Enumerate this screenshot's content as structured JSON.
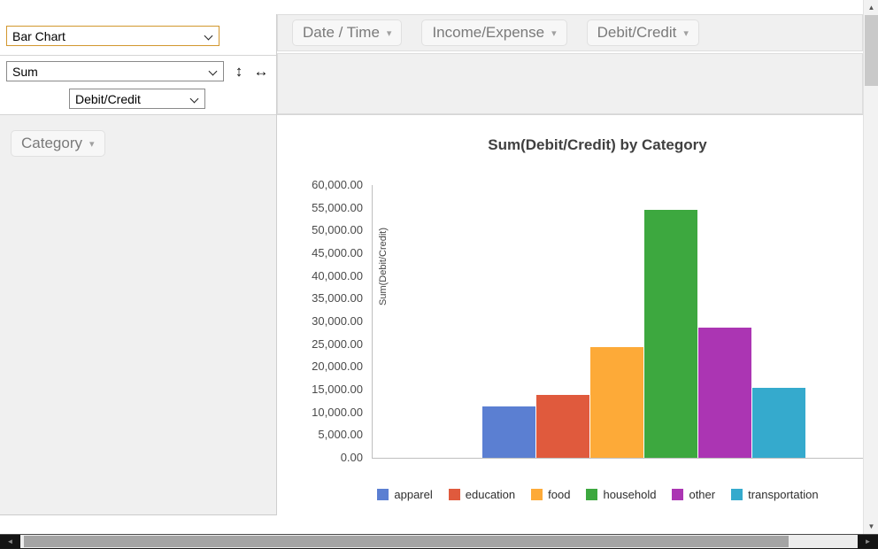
{
  "controls": {
    "renderer_select": {
      "value": "Bar Chart"
    },
    "aggregator_select": {
      "value": "Sum"
    },
    "aggregator_arg_select": {
      "value": "Debit/Credit"
    },
    "order_arrows": {
      "vertical": "↕",
      "horizontal": "↔"
    }
  },
  "attribute_pills": {
    "caret_glyph": "▾",
    "unused": [
      "Date / Time",
      "Income/Expense",
      "Debit/Credit"
    ],
    "rows": [
      "Category"
    ],
    "cols": []
  },
  "icons": {
    "scroll_up": "▲",
    "scroll_down": "▼",
    "scroll_left": "◄",
    "scroll_right": "►"
  },
  "chart_data": {
    "type": "bar",
    "title": "Sum(Debit/Credit) by Category",
    "xlabel": "",
    "ylabel": "Sum(Debit/Credit)",
    "categories": [
      "apparel",
      "education",
      "food",
      "household",
      "other",
      "transportation"
    ],
    "values": [
      11300,
      13800,
      24400,
      54600,
      28700,
      15400
    ],
    "colors": [
      "#5b7fd2",
      "#e05a3d",
      "#fdaa38",
      "#3da83f",
      "#ab35b3",
      "#35aacd"
    ],
    "ylim": [
      0,
      60000
    ],
    "ytick_labels": [
      "0.00",
      "5,000.00",
      "10,000.00",
      "15,000.00",
      "20,000.00",
      "25,000.00",
      "30,000.00",
      "35,000.00",
      "40,000.00",
      "45,000.00",
      "50,000.00",
      "55,000.00",
      "60,000.00"
    ],
    "legend_entries": [
      "apparel",
      "education",
      "food",
      "household",
      "other",
      "transportation"
    ],
    "legend_position": "bottom",
    "grid": false
  }
}
